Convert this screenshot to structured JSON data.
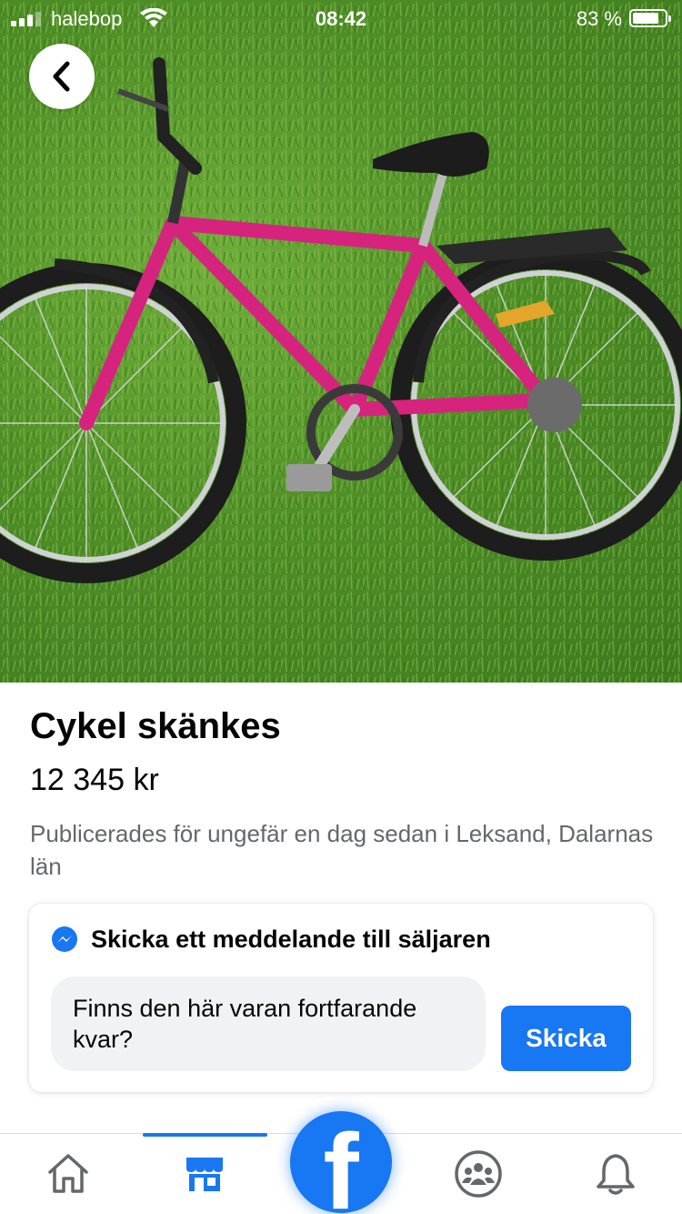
{
  "status_bar": {
    "carrier": "halebop",
    "time": "08:42",
    "battery_percent": "83 %",
    "battery_level": 0.83
  },
  "listing": {
    "title": "Cykel skänkes",
    "price": "12 345 kr",
    "meta": "Publicerades för ungefär en dag sedan i Leksand, Dalarnas län"
  },
  "message_card": {
    "heading": "Skicka ett meddelande till säljaren",
    "message": "Finns den här varan fortfarande kvar?",
    "send_label": "Skicka"
  },
  "tabbar": {
    "tabs": [
      "home-icon",
      "marketplace-icon",
      "facebook-logo",
      "groups-icon",
      "notifications-icon"
    ],
    "active_tab": "marketplace-icon",
    "logo_letter": "f"
  },
  "colors": {
    "accent": "#1877f2",
    "bike_frame": "#d6247e",
    "text_secondary": "#65676b"
  }
}
